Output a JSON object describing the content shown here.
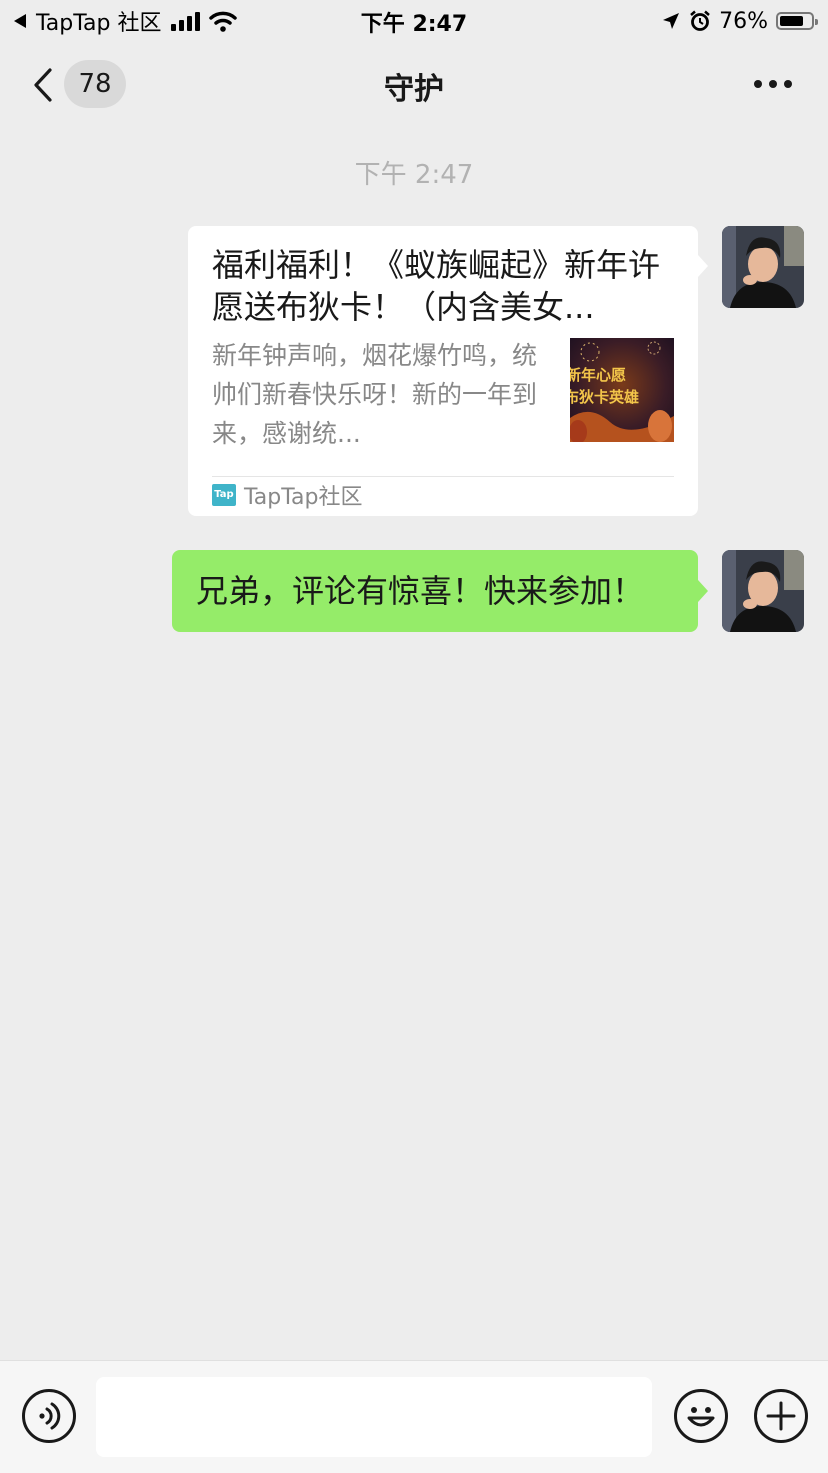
{
  "status_bar": {
    "back_app": "TapTap 社区",
    "time": "下午 2:47",
    "battery_percent": "76%",
    "battery_level": 0.76
  },
  "nav": {
    "unread_count": "78",
    "title": "守护"
  },
  "chat": {
    "timestamp": "下午 2:47",
    "messages": [
      {
        "type": "link_card",
        "title": "福利福利！《蚁族崛起》新年许愿送布狄卡！（内含美女...",
        "description": "新年钟声响，烟花爆竹鸣，统帅们新春快乐呀！新的一年到来，感谢统...",
        "thumbnail_text_1": "新年心愿",
        "thumbnail_text_2": "布狄卡英雄",
        "source_icon_text": "Tap",
        "source_name": "TapTap社区"
      },
      {
        "type": "text",
        "text": "兄弟，评论有惊喜！快来参加！"
      }
    ]
  },
  "input_bar": {
    "message_value": ""
  },
  "colors": {
    "background": "#ededed",
    "my_bubble": "#95ec69",
    "card_bg": "#ffffff",
    "timestamp": "#b2b2b2",
    "source_icon": "#3fb4c9"
  }
}
